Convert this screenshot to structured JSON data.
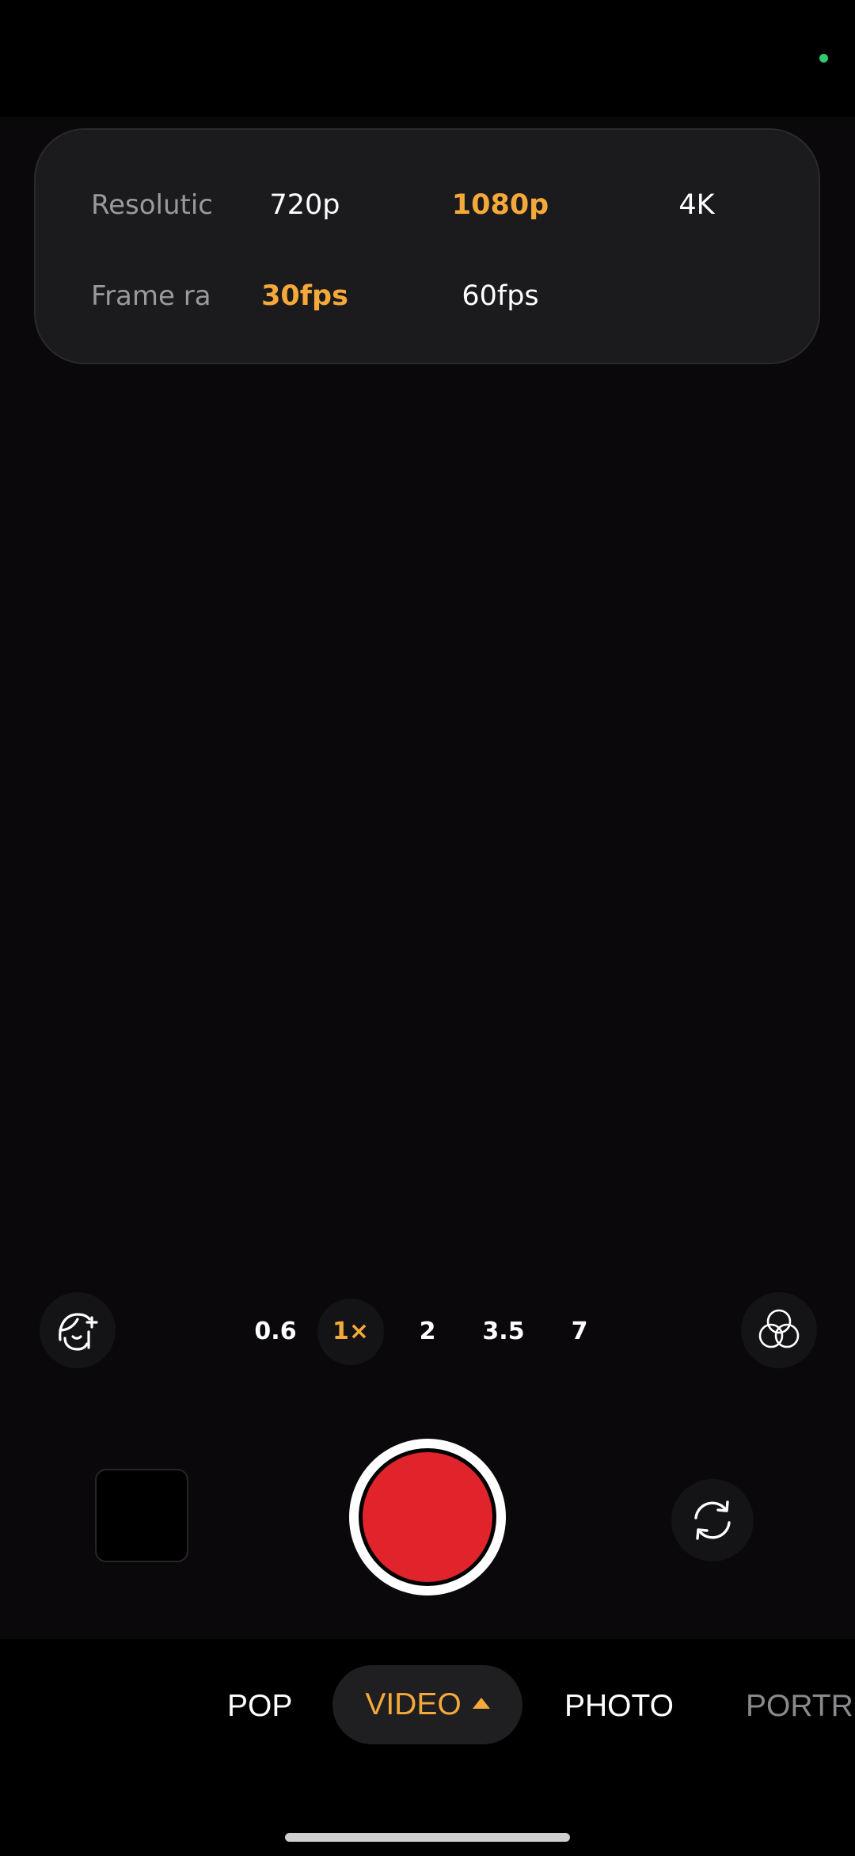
{
  "settings": {
    "resolution": {
      "label": "Resolutic",
      "options": [
        "720p",
        "1080p",
        "4K"
      ],
      "selected": "1080p"
    },
    "frame_rate": {
      "label": "Frame ra",
      "options": [
        "30fps",
        "60fps"
      ],
      "selected": "30fps"
    }
  },
  "zoom": {
    "levels": [
      "0.6",
      "1×",
      "2",
      "3.5",
      "7"
    ],
    "selected": "1×"
  },
  "modes": {
    "pop": "POP",
    "video": "VIDEO",
    "photo": "PHOTO",
    "portrait": "PORTR"
  },
  "icons": {
    "beauty": "beauty-face-icon",
    "filter": "filter-circles-icon",
    "flip": "flip-camera-icon"
  },
  "colors": {
    "accent": "#f4a93a",
    "record": "#e1232b",
    "privacy_dot": "#2ecc71"
  }
}
